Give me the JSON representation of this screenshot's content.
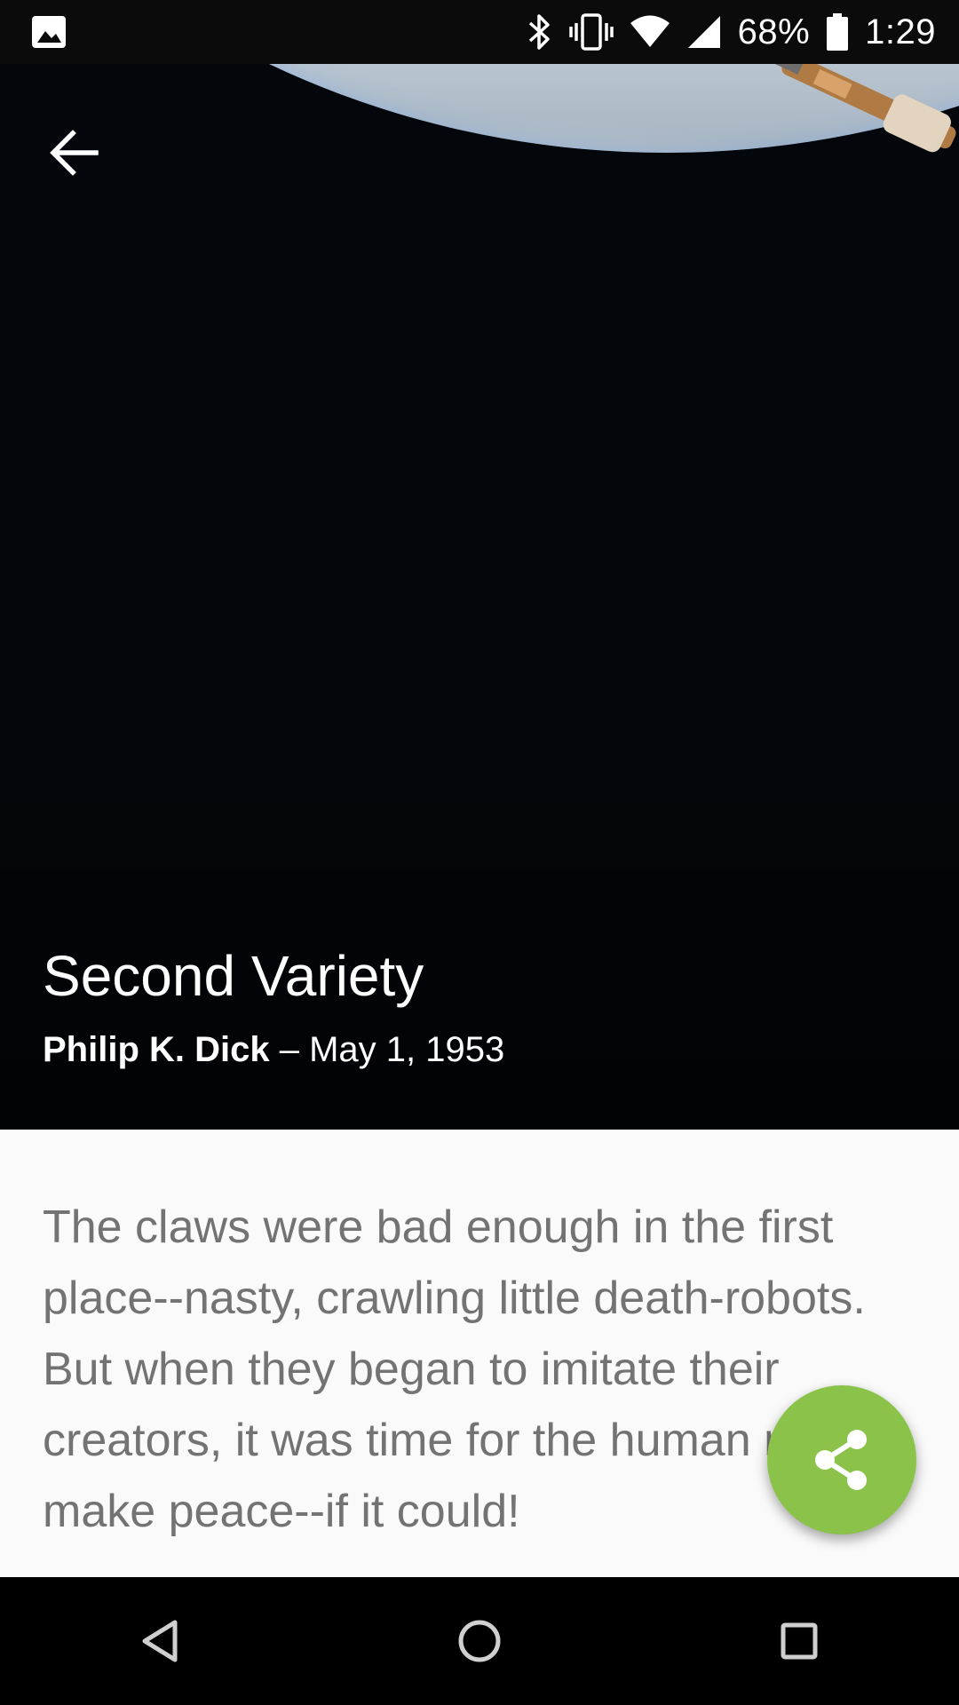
{
  "status_bar": {
    "battery_percent": "68%",
    "time": "1:29",
    "icons": [
      "image-icon",
      "bluetooth-icon",
      "vibrate-icon",
      "wifi-icon",
      "signal-icon",
      "battery-icon"
    ]
  },
  "hero": {
    "title": "Second Variety",
    "author": "Philip K. Dick",
    "separator": " – ",
    "date": "May 1, 1953",
    "back_icon": "arrow-back-icon"
  },
  "content": {
    "blurb": "The claws were bad enough in the first place--nasty, crawling little death-robots. But when they began to imitate their creators, it was time for the human race to make peace--if it could!"
  },
  "fab": {
    "icon": "share-icon",
    "color": "#8bc34a"
  },
  "nav_bar": {
    "buttons": [
      "back-triangle-icon",
      "home-circle-icon",
      "recents-square-icon"
    ]
  }
}
